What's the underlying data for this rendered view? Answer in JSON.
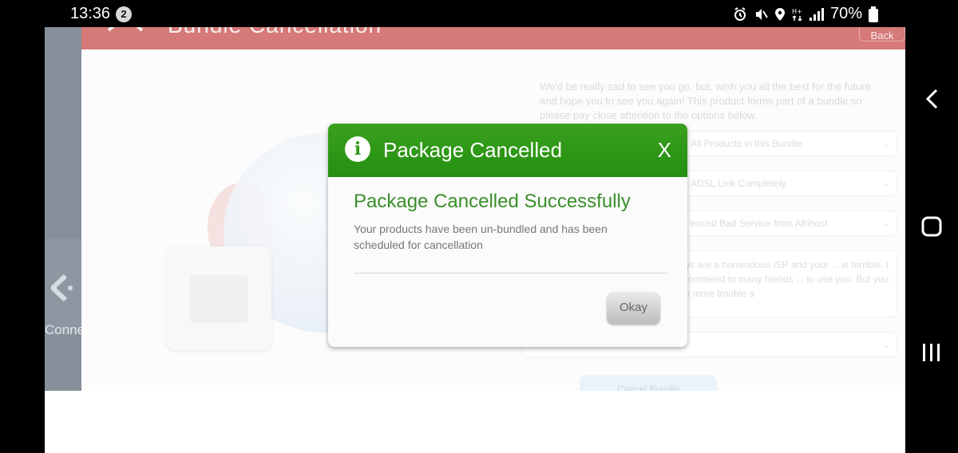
{
  "status_bar": {
    "time": "13:36",
    "notification_count": "2",
    "battery_percent": "70%",
    "icons": [
      "alarm-icon",
      "mute-icon",
      "location-icon",
      "data-arrows-icon",
      "signal-icon",
      "battery-icon"
    ]
  },
  "app": {
    "header_title": "Bundle Cancellation",
    "back_label": "Back",
    "left_label": "Conne",
    "panel": {
      "intro": "We'd be really sad to see you go, but, wish you all the best for the future and hope you to see you again! This product forms part of a bundle so please pay close attention to the options below.",
      "select1": "All Products in this Bundle",
      "select2": "ADSL Link Completely",
      "select3": "enced Bad Service from Afrihost",
      "comment": "guys are a horrendous ISP and your ... is terrible. I recommend to many friends ... to use you. But you can more trouble a",
      "small_select": "",
      "button": "Cancel Bundle"
    }
  },
  "dialog": {
    "title": "Package Cancelled",
    "close_label": "X",
    "heading": "Package Cancelled Successfully",
    "message": "Your products have been un-bundled and has been scheduled for cancellation",
    "ok_label": "Okay"
  },
  "colors": {
    "header_red": "#b40b0b",
    "dialog_green": "#2f9a18",
    "heading_green": "#3a8f2a"
  }
}
